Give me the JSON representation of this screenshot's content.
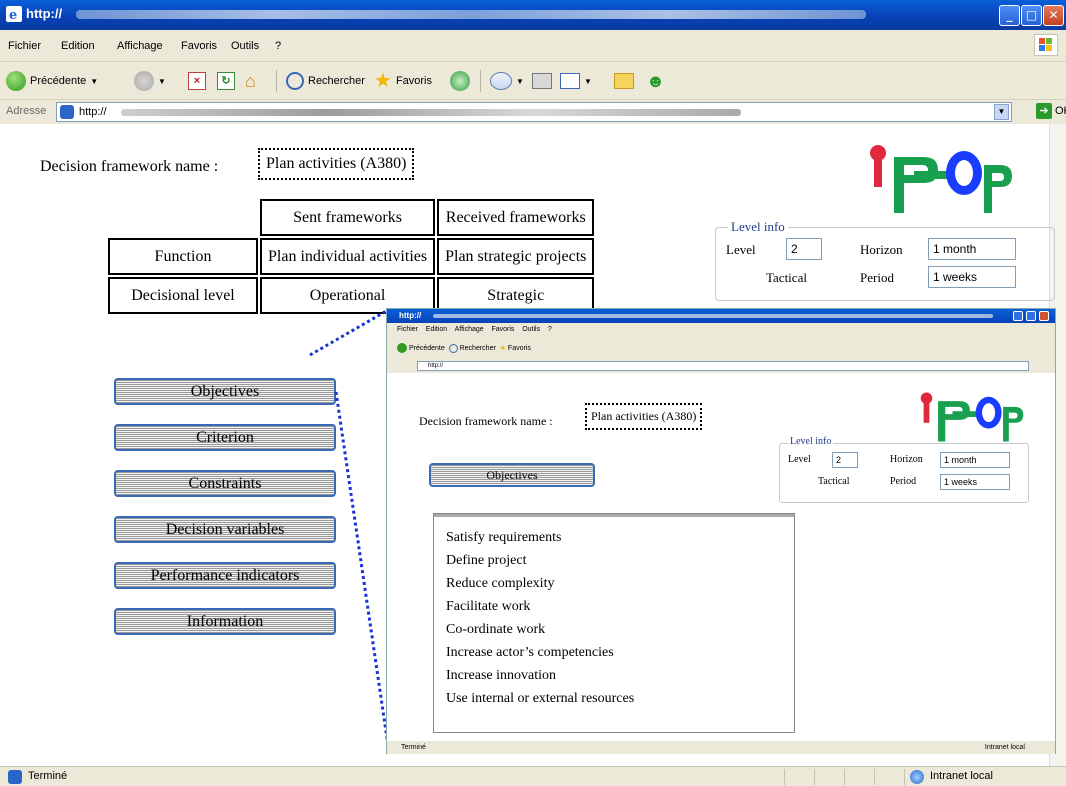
{
  "window": {
    "title": "http://"
  },
  "menu": [
    "Fichier",
    "Edition",
    "Affichage",
    "Favoris",
    "Outils",
    "?"
  ],
  "toolbar": {
    "back": "Précédente",
    "search": "Rechercher",
    "favorites": "Favoris"
  },
  "address": {
    "label": "Adresse",
    "value": "http://",
    "go": "OK"
  },
  "page": {
    "dfn_label": "Decision framework name :",
    "dfn_value": "Plan activities (A380)",
    "table": {
      "headers": [
        "Sent frameworks",
        "Received frameworks"
      ],
      "rows": [
        {
          "label": "Function",
          "sent": "Plan individual activities",
          "received": "Plan strategic projects"
        },
        {
          "label": "Decisional level",
          "sent": "Operational",
          "received": "Strategic"
        }
      ]
    },
    "level_info": {
      "legend": "Level info",
      "level_label": "Level",
      "level_value": "2",
      "horizon_label": "Horizon",
      "horizon_value": "1 month",
      "tactical_label": "Tactical",
      "period_label": "Period",
      "period_value": "1 weeks"
    },
    "buttons": [
      "Objectives",
      "Criterion",
      "Constraints",
      "Decision variables",
      "Performance indicators",
      "Information"
    ]
  },
  "inset": {
    "title": "http://",
    "menu": [
      "Fichier",
      "Edition",
      "Affichage",
      "Favoris",
      "Outils",
      "?"
    ],
    "objectives_button": "Objectives",
    "objectives": [
      "Satisfy requirements",
      "Define project",
      "Reduce complexity",
      "Facilitate work",
      "Co-ordinate work",
      "Increase actor’s competencies",
      "Increase innovation",
      "Use internal or external resources"
    ],
    "status_left": "Terminé",
    "status_right": "Intranet local"
  },
  "status": {
    "left": "Terminé",
    "right": "Intranet local"
  },
  "colors": {
    "title_bar": "#0842b8",
    "button_border": "#3a6ab5",
    "logo_red": "#e0283c",
    "logo_green": "#18a050",
    "logo_blue": "#1a3cff"
  }
}
